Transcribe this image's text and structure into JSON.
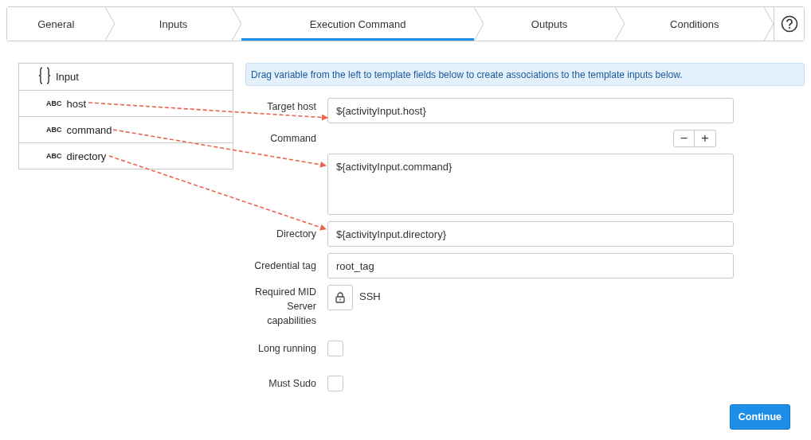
{
  "tabs": [
    {
      "label": "General",
      "selected": false
    },
    {
      "label": "Inputs",
      "selected": false
    },
    {
      "label": "Execution Command",
      "selected": true
    },
    {
      "label": "Outputs",
      "selected": false
    },
    {
      "label": "Conditions",
      "selected": false
    }
  ],
  "variables": {
    "label": "Input",
    "children": [
      {
        "type": "ABC",
        "label": "host"
      },
      {
        "type": "ABC",
        "label": "command"
      },
      {
        "type": "ABC",
        "label": "directory"
      }
    ]
  },
  "banner": "Drag variable from the left to template fields below to create associations to the template inputs below.",
  "fields": [
    {
      "kind": "text",
      "label": "Target host",
      "value": "${activityInput.host}"
    },
    {
      "kind": "textarea",
      "label": "Command",
      "value": "${activityInput.command}",
      "buttons": [
        "−",
        "+"
      ]
    },
    {
      "kind": "text",
      "label": "Directory",
      "value": "${activityInput.directory}"
    },
    {
      "kind": "text",
      "label": "Credential tag",
      "value": "root_tag"
    },
    {
      "kind": "capability",
      "label": "Required MID Server capabilities",
      "value": "SSH"
    },
    {
      "kind": "checkbox",
      "label": "Long running",
      "checked": false
    },
    {
      "kind": "checkbox",
      "label": "Must Sudo",
      "checked": false
    }
  ],
  "continue": "Continue"
}
